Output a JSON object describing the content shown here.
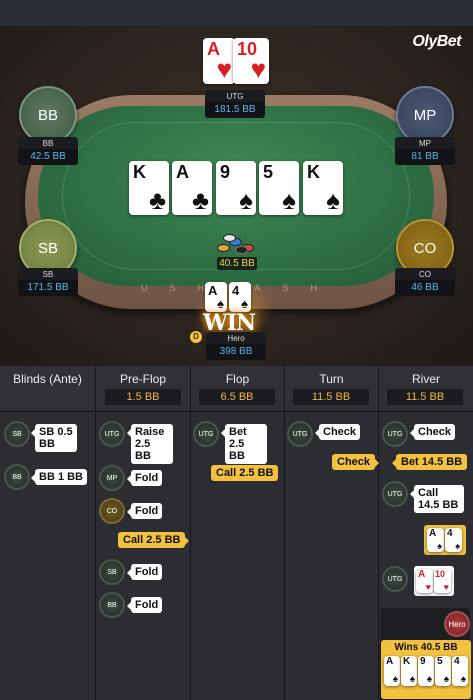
{
  "brand": "OlyBet",
  "table": {
    "rail_text": "USHCASH"
  },
  "seats": {
    "utg": {
      "name": "UTG",
      "stack": "181.5 BB"
    },
    "bb": {
      "label": "BB",
      "name": "BB",
      "stack": "42.5 BB"
    },
    "mp": {
      "label": "MP",
      "name": "MP",
      "stack": "81 BB"
    },
    "sb": {
      "label": "SB",
      "name": "SB",
      "stack": "171.5 BB"
    },
    "co": {
      "label": "CO",
      "name": "CO",
      "stack": "46 BB"
    },
    "hero": {
      "name": "Hero",
      "stack": "398 BB",
      "dealer": "D"
    }
  },
  "utg_cards": [
    {
      "rank": "A",
      "suit": "♥"
    },
    {
      "rank": "10",
      "suit": "♥"
    }
  ],
  "board": [
    {
      "rank": "K",
      "suit": "♣"
    },
    {
      "rank": "A",
      "suit": "♣"
    },
    {
      "rank": "9",
      "suit": "♠"
    },
    {
      "rank": "5",
      "suit": "♠"
    },
    {
      "rank": "K",
      "suit": "♠"
    }
  ],
  "hero_cards": [
    {
      "rank": "A",
      "suit": "♠"
    },
    {
      "rank": "4",
      "suit": "♠"
    }
  ],
  "pot": "40.5 BB",
  "win_text": "WIN",
  "colors": {
    "felt": "#2f7045",
    "accent": "#f2c140",
    "stack_blue": "#58b6ea"
  },
  "history": {
    "columns": [
      {
        "title": "Blinds (Ante)",
        "pot": ""
      },
      {
        "title": "Pre-Flop",
        "pot": "1.5 BB"
      },
      {
        "title": "Flop",
        "pot": "6.5 BB"
      },
      {
        "title": "Turn",
        "pot": "11.5 BB"
      },
      {
        "title": "River",
        "pot": "11.5 BB"
      }
    ],
    "blinds": [
      {
        "pos": "SB",
        "text": "SB 0.5 BB"
      },
      {
        "pos": "BB",
        "text": "BB 1 BB"
      }
    ],
    "preflop": [
      {
        "pos": "UTG",
        "text": "Raise 2.5 BB"
      },
      {
        "pos": "MP",
        "text": "Fold"
      },
      {
        "pos": "CO",
        "text": "Fold"
      },
      {
        "pos": "Hero",
        "text": "Call 2.5 BB"
      },
      {
        "pos": "SB",
        "text": "Fold"
      },
      {
        "pos": "BB",
        "text": "Fold"
      }
    ],
    "flop": [
      {
        "pos": "UTG",
        "text": "Bet 2.5 BB"
      },
      {
        "pos": "Hero",
        "text": "Call 2.5 BB"
      }
    ],
    "turn": [
      {
        "pos": "UTG",
        "text": "Check"
      },
      {
        "pos": "Hero",
        "text": "Check"
      }
    ],
    "river": [
      {
        "pos": "UTG",
        "text": "Check"
      },
      {
        "pos": "Hero",
        "text": "Bet 14.5 BB"
      },
      {
        "pos": "UTG",
        "text": "Call 14.5 BB"
      },
      {
        "pos": "UTG",
        "text": "shows"
      },
      {
        "pos": "Hero",
        "text": "Hero"
      }
    ],
    "wins": "Wins 40.5 BB",
    "final_hand": [
      {
        "rank": "A",
        "suit": "♠"
      },
      {
        "rank": "K",
        "suit": "♠"
      },
      {
        "rank": "9",
        "suit": "♠"
      },
      {
        "rank": "5",
        "suit": "♠"
      },
      {
        "rank": "4",
        "suit": "♠"
      }
    ]
  }
}
